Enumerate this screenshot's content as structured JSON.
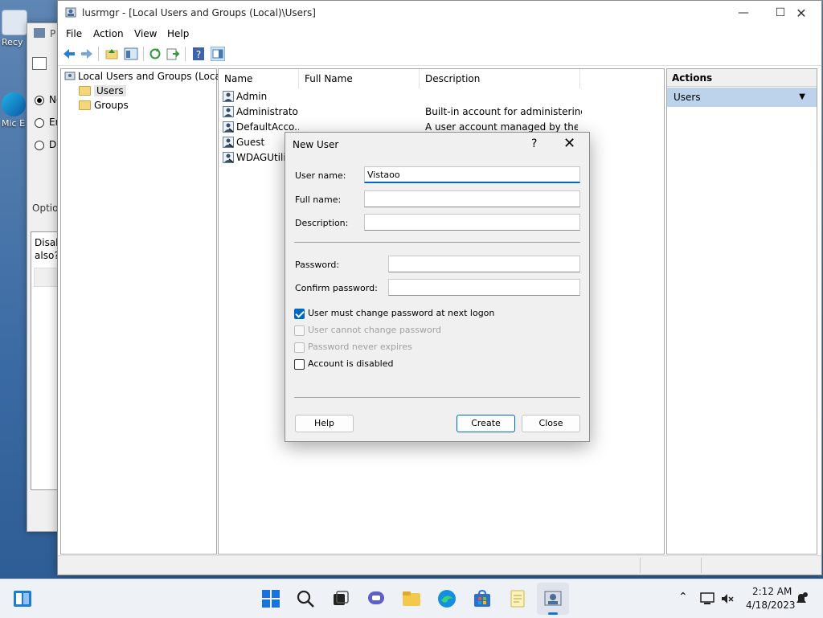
{
  "desktop": {
    "icons": [
      {
        "label": "Recy"
      },
      {
        "label": "Mic E"
      }
    ]
  },
  "bg_dialog": {
    "title": "P",
    "radio1": "No",
    "radio2": "En",
    "radio3": "Di",
    "options_label": "Optio",
    "box_text_1": "Disab",
    "box_text_2": "also?"
  },
  "mmc": {
    "title": "lusrmgr - [Local Users and Groups (Local)\\Users]",
    "menu": [
      "File",
      "Action",
      "View",
      "Help"
    ],
    "tree": {
      "root": "Local Users and Groups (Local)",
      "users": "Users",
      "groups": "Groups"
    },
    "columns": [
      "Name",
      "Full Name",
      "Description"
    ],
    "rows": [
      {
        "name": "Admin",
        "full_name": "",
        "description": ""
      },
      {
        "name": "Administrator",
        "full_name": "",
        "description": "Built-in account for administering..."
      },
      {
        "name": "DefaultAcco...",
        "full_name": "",
        "description": "A user account managed by the s..."
      },
      {
        "name": "Guest",
        "full_name": "",
        "description": ""
      },
      {
        "name": "WDAGUtilit",
        "full_name": "",
        "description": ""
      }
    ],
    "actions": {
      "header": "Actions",
      "item": "Users"
    }
  },
  "new_user": {
    "title": "New User",
    "help_glyph": "?",
    "close_glyph": "✕",
    "user_name_label": "User name:",
    "user_name_value": "Vistaoo",
    "full_name_label": "Full name:",
    "full_name_value": "",
    "description_label": "Description:",
    "description_value": "",
    "password_label": "Password:",
    "confirm_label": "Confirm password:",
    "checkboxes": [
      {
        "label": "User must change password at next logon",
        "checked": true,
        "disabled": false
      },
      {
        "label": "User cannot change password",
        "checked": false,
        "disabled": true
      },
      {
        "label": "Password never expires",
        "checked": false,
        "disabled": true
      },
      {
        "label": "Account is disabled",
        "checked": false,
        "disabled": false
      }
    ],
    "buttons": {
      "help": "Help",
      "create": "Create",
      "close": "Close"
    }
  },
  "taskbar": {
    "time": "2:12 AM",
    "date": "4/18/2023"
  },
  "colors": {
    "accent": "#0067c0",
    "selection": "#bcd3eb"
  }
}
